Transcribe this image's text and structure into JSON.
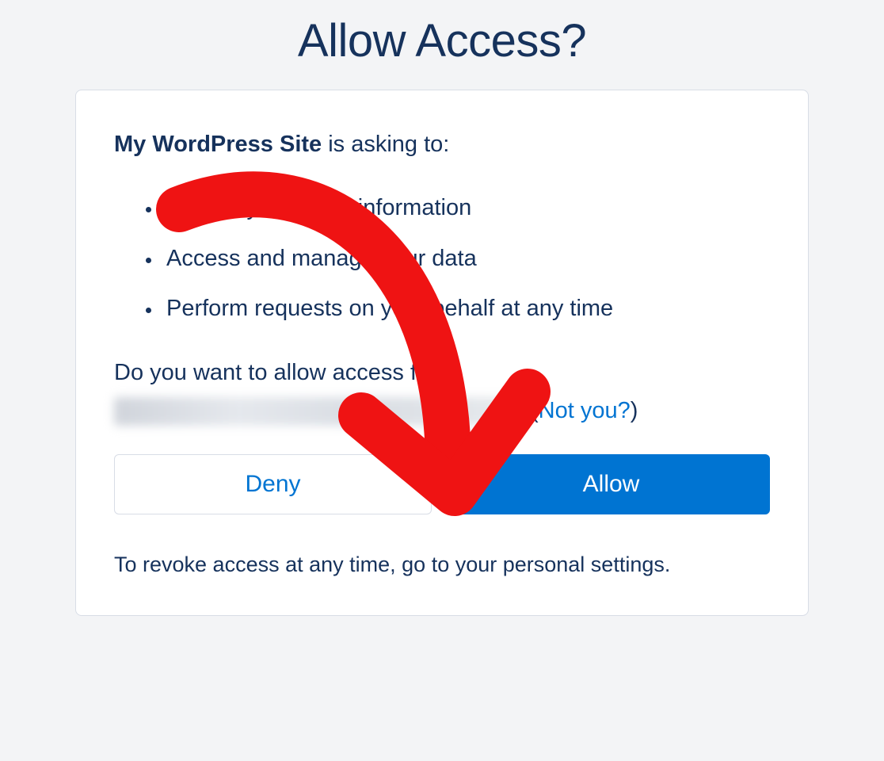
{
  "title": "Allow Access?",
  "app_name": "My WordPress Site",
  "asking_suffix": " is asking to:",
  "permissions": [
    "Access your basic information",
    "Access and manage your data",
    "Perform requests on your behalf at any time"
  ],
  "question": "Do you want to allow access for",
  "not_you_open": " (",
  "not_you": "Not you?",
  "not_you_close": ")",
  "buttons": {
    "deny": "Deny",
    "allow": "Allow"
  },
  "footnote": "To revoke access at any time, go to your personal settings.",
  "annotation": {
    "arrow_color": "#ef1313"
  }
}
